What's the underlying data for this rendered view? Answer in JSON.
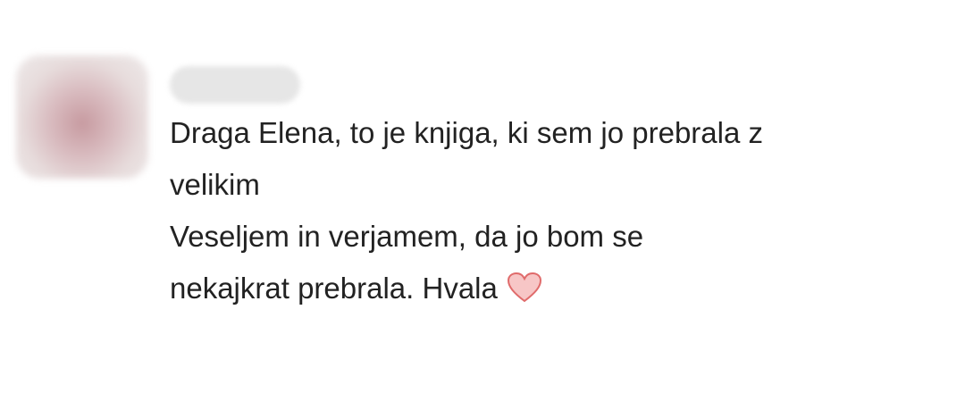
{
  "comment": {
    "author_name": "",
    "lines": [
      "Draga Elena, to je knjiga, ki sem jo prebrala z",
      "velikim",
      "Veseljem in verjamem, da jo bom se",
      "nekajkrat prebrala. Hvala"
    ],
    "emoji": "heart-icon",
    "colors": {
      "text": "#222222",
      "heart_fill": "#f7c6c6",
      "heart_stroke": "#e06b6b"
    }
  }
}
